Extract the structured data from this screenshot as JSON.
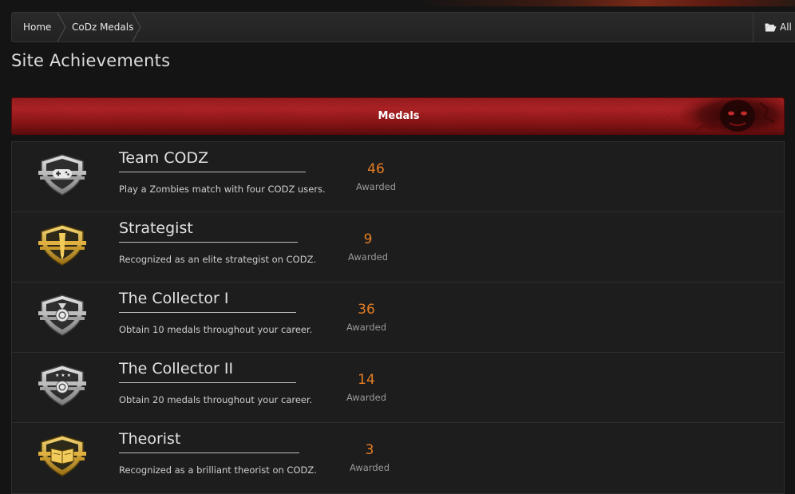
{
  "breadcrumb": {
    "home_label": "Home",
    "current_label": "CoDz Medals",
    "all_label": "All A",
    "all_icon": "folder-open-icon"
  },
  "page_title": "Site Achievements",
  "section": {
    "title": "Medals",
    "accent": "#b02326"
  },
  "medals": [
    {
      "name": "Team CODZ",
      "description": "Play a Zombies match with four CODZ users.",
      "count": "46",
      "count_label": "Awarded",
      "badge": "silver",
      "emblem": "gamepad-icon"
    },
    {
      "name": "Strategist",
      "description": "Recognized as an elite strategist on CODZ.",
      "count": "9",
      "count_label": "Awarded",
      "badge": "gold",
      "emblem": "pen-icon"
    },
    {
      "name": "The Collector I",
      "description": "Obtain 10 medals throughout your career.",
      "count": "36",
      "count_label": "Awarded",
      "badge": "silver",
      "emblem": "medal-icon"
    },
    {
      "name": "The Collector II",
      "description": "Obtain 20 medals throughout your career.",
      "count": "14",
      "count_label": "Awarded",
      "badge": "silver",
      "emblem": "medal-stars-icon"
    },
    {
      "name": "Theorist",
      "description": "Recognized as a brilliant theorist on CODZ.",
      "count": "3",
      "count_label": "Awarded",
      "badge": "gold",
      "emblem": "book-icon"
    }
  ]
}
